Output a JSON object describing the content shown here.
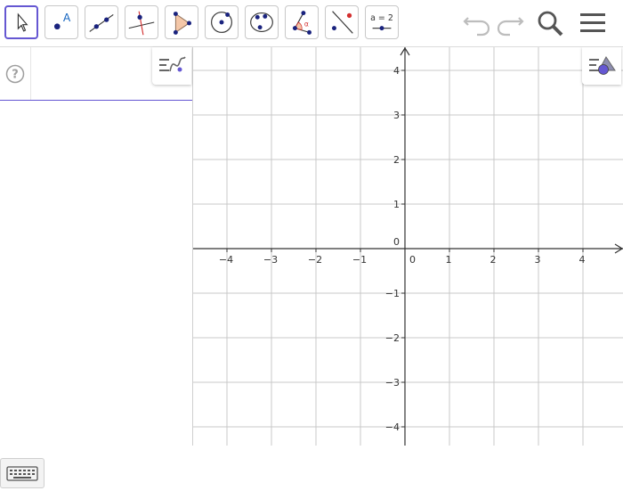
{
  "toolbar": {
    "tools": [
      {
        "name": "move-tool-button",
        "icon": "cursor-arrow-icon"
      },
      {
        "name": "point-tool-button",
        "icon": "point-icon",
        "label": "A"
      },
      {
        "name": "line-tool-button",
        "icon": "line-through-points-icon"
      },
      {
        "name": "perpendicular-line-tool-button",
        "icon": "perpendicular-line-icon"
      },
      {
        "name": "polygon-tool-button",
        "icon": "polygon-icon"
      },
      {
        "name": "circle-tool-button",
        "icon": "circle-center-point-icon"
      },
      {
        "name": "conic-tool-button",
        "icon": "ellipse-icon"
      },
      {
        "name": "angle-tool-button",
        "icon": "angle-icon",
        "label": "α"
      },
      {
        "name": "reflect-tool-button",
        "icon": "reflect-about-line-icon"
      },
      {
        "name": "slider-tool-button",
        "icon": "slider-icon",
        "label": "a = 2"
      }
    ],
    "right_icons": [
      "undo-icon",
      "redo-icon",
      "search-icon",
      "menu-icon"
    ]
  },
  "algebra": {
    "help_icon": "help-icon",
    "input_placeholder": "",
    "style_button_icon": "algebra-style-bar-icon",
    "keyboard_icon": "keyboard-icon"
  },
  "graphics": {
    "style_button_icon": "graphics-style-bar-icon",
    "x_ticks": [
      "−4",
      "−3",
      "−2",
      "−1",
      "0",
      "1",
      "2",
      "3",
      "4"
    ],
    "y_ticks": [
      "4",
      "3",
      "2",
      "1",
      "0",
      "−1",
      "−2",
      "−3",
      "−4"
    ],
    "axis_color": "#333333",
    "grid_color": "#c8c8c8"
  },
  "colors": {
    "accent": "#6557d2",
    "point": "#1a237e",
    "polygon_fill": "#f4c7a8",
    "red": "#d32f2f"
  }
}
